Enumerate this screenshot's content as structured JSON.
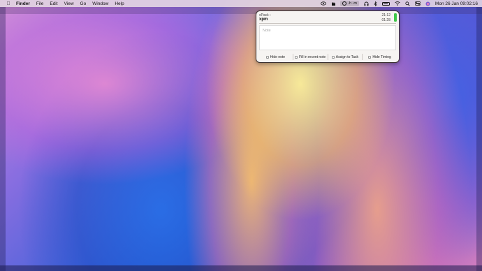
{
  "menubar": {
    "app_name": "Finder",
    "menus": [
      "File",
      "Edit",
      "View",
      "Go",
      "Window",
      "Help"
    ],
    "timer_label": "-h -m",
    "datetime": "Mon 26 Jan  09:02:16",
    "status_icons": [
      "spotlight-eye-icon",
      "app-icon",
      "timer-clock-icon",
      "headphones-icon",
      "bluetooth-icon",
      "battery-icon",
      "wifi-icon",
      "search-icon",
      "control-center-icon",
      "siri-icon"
    ]
  },
  "popover": {
    "project": "xPack ›",
    "task": "xpm",
    "time_top": "21:12",
    "time_bottom": "01:28",
    "note_placeholder": "Note",
    "actions": [
      "Hide note",
      "Fill in recent note",
      "Assign to Task",
      "Hide Timing"
    ],
    "status_color": "#3fc84a"
  }
}
